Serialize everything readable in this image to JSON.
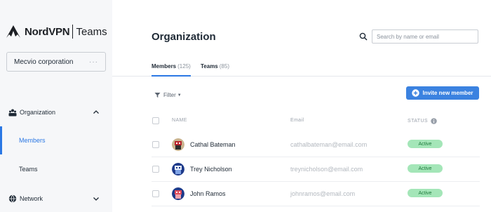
{
  "brand": {
    "name": "NordVPN",
    "product": "Teams"
  },
  "organization": {
    "name": "Mecvio corporation",
    "more": "···"
  },
  "sidebar": {
    "groups": [
      {
        "label": "Organization",
        "icon": "organization-icon",
        "expanded": true
      },
      {
        "label": "Network",
        "icon": "network-icon",
        "expanded": false
      }
    ],
    "items": [
      {
        "label": "Members",
        "active": true
      },
      {
        "label": "Teams",
        "active": false
      }
    ]
  },
  "header": {
    "title": "Organization",
    "search_placeholder": "Search by name or email"
  },
  "tabs": [
    {
      "label": "Members",
      "count": "(125)",
      "active": true
    },
    {
      "label": "Teams",
      "count": "(85)",
      "active": false
    }
  ],
  "toolbar": {
    "filter_label": "Filter",
    "invite_label": "Invite new member"
  },
  "table": {
    "columns": {
      "name": "NAME",
      "email": "Email",
      "status": "STATUS"
    },
    "rows": [
      {
        "name": "Cathal Bateman",
        "email": "cathalbateman@email.com",
        "status": "Active"
      },
      {
        "name": "Trey Nicholson",
        "email": "treynicholson@email.com",
        "status": "Active"
      },
      {
        "name": "John Ramos",
        "email": "johnramos@email.com",
        "status": "Active"
      }
    ]
  },
  "colors": {
    "accent": "#2b78e4",
    "button": "#3b82e0",
    "status_bg": "#a4e6b8",
    "sidebar_bg": "#f6f7f9"
  }
}
